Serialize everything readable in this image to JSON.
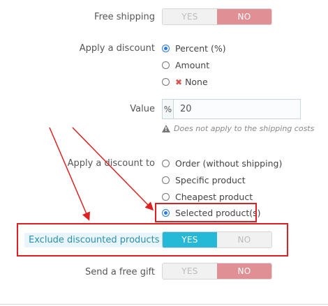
{
  "free_shipping": {
    "label": "Free shipping",
    "yes": "YES",
    "no": "NO",
    "selected": "NO"
  },
  "apply_discount": {
    "label": "Apply a discount",
    "options": [
      {
        "label": "Percent (%)",
        "checked": true
      },
      {
        "label": "Amount",
        "checked": false
      },
      {
        "label": "None",
        "checked": false,
        "icon": "x-icon"
      }
    ]
  },
  "value": {
    "label": "Value",
    "addon": "%",
    "input_value": "20"
  },
  "help_text": "Does not apply to the shipping costs",
  "apply_discount_to": {
    "label": "Apply a discount to",
    "options": [
      {
        "label": "Order (without shipping)",
        "checked": false
      },
      {
        "label": "Specific product",
        "checked": false
      },
      {
        "label": "Cheapest product",
        "checked": false
      },
      {
        "label": "Selected product(s)",
        "checked": true
      }
    ]
  },
  "exclude_discounted": {
    "label": "Exclude discounted products",
    "yes": "YES",
    "no": "NO",
    "selected": "YES"
  },
  "free_gift": {
    "label": "Send a free gift",
    "yes": "YES",
    "no": "NO",
    "selected": "NO"
  },
  "colors": {
    "accent_blue": "#25b9d7",
    "no_active": "#e08f95",
    "annotation_red": "#e02020",
    "radio_blue": "#2a7ae2"
  }
}
